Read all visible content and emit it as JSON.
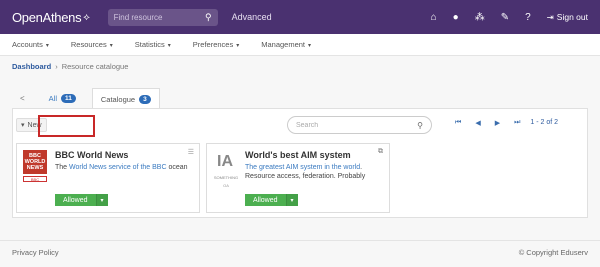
{
  "header": {
    "logo_text": "OpenAthens",
    "search_placeholder": "Find resource",
    "advanced_label": "Advanced",
    "signout_label": "Sign out"
  },
  "menu": {
    "items": [
      {
        "label": "Accounts"
      },
      {
        "label": "Resources"
      },
      {
        "label": "Statistics"
      },
      {
        "label": "Preferences"
      },
      {
        "label": "Management"
      }
    ]
  },
  "breadcrumb": {
    "home": "Dashboard",
    "current": "Resource catalogue"
  },
  "tabs": {
    "back": "<",
    "items": [
      {
        "label": "All",
        "count": "11"
      },
      {
        "label": "Catalogue",
        "count": "3"
      }
    ]
  },
  "toolbar": {
    "filter_label": "New",
    "search_placeholder": "Search",
    "pager_first": "⏮",
    "pager_prev": "◀",
    "pager_next": "▶",
    "pager_last": "⏭",
    "pager_count": "1 - 2 of 2"
  },
  "cards": [
    {
      "title": "BBC World News",
      "desc_pre": "The ",
      "desc_link": "World News service of the BBC",
      "desc_post": " ocean",
      "logo_text": "BBC WORLD NEWS",
      "strip_text": "BBC",
      "action_label": "Allowed"
    },
    {
      "title": "World's best AIM system",
      "desc_pre": "",
      "desc_link": "The greatest AIM system in the world",
      "desc_post": ". Resource access, federation. Probably",
      "logo_text": "IA",
      "logo_sub": "SOMETHING",
      "logo_sub2": "OA",
      "action_label": "Allowed"
    }
  ],
  "footer": {
    "privacy": "Privacy Policy",
    "copyright": "© Copyright Eduserv"
  }
}
